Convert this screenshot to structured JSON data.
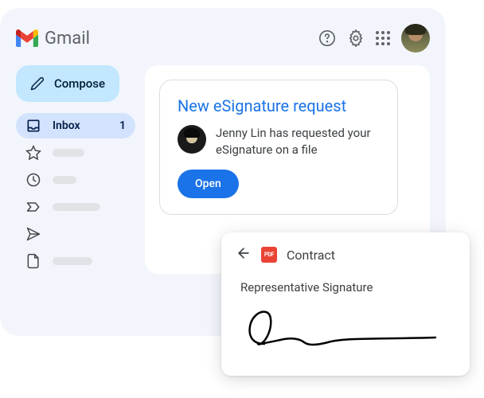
{
  "app": {
    "title": "Gmail"
  },
  "sidebar": {
    "compose_label": "Compose",
    "inbox": {
      "label": "Inbox",
      "count": "1"
    }
  },
  "esignature": {
    "title": "New eSignature request",
    "message": "Jenny Lin has requested your eSignature on a file",
    "open_label": "Open"
  },
  "contract": {
    "pdf_badge": "PDF",
    "title": "Contract",
    "signature_label": "Representative Signature"
  }
}
